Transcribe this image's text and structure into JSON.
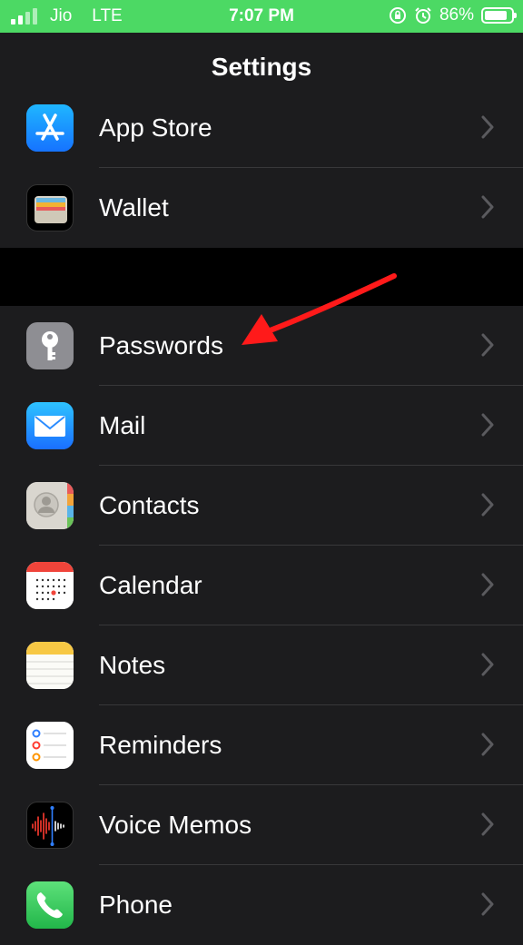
{
  "status_bar": {
    "carrier": "Jio",
    "network": "LTE",
    "time": "7:07 PM",
    "battery_percent": "86%",
    "battery_level": 0.86,
    "color": "#4cd964"
  },
  "nav": {
    "title": "Settings"
  },
  "groups": [
    {
      "items": [
        {
          "label": "App Store",
          "icon": "app-store-icon"
        },
        {
          "label": "Wallet",
          "icon": "wallet-icon"
        }
      ]
    },
    {
      "items": [
        {
          "label": "Passwords",
          "icon": "key-icon"
        },
        {
          "label": "Mail",
          "icon": "mail-icon"
        },
        {
          "label": "Contacts",
          "icon": "contacts-icon"
        },
        {
          "label": "Calendar",
          "icon": "calendar-icon"
        },
        {
          "label": "Notes",
          "icon": "notes-icon"
        },
        {
          "label": "Reminders",
          "icon": "reminders-icon"
        },
        {
          "label": "Voice Memos",
          "icon": "voice-memos-icon"
        },
        {
          "label": "Phone",
          "icon": "phone-icon"
        }
      ]
    }
  ],
  "annotation": {
    "color": "#ff1a1a"
  }
}
